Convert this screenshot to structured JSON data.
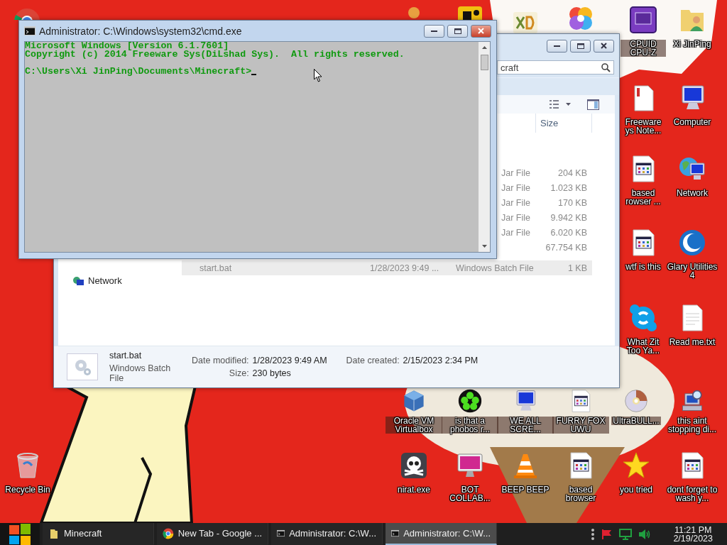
{
  "desktop": {
    "icons": [
      {
        "kind": "circle-logo"
      },
      {
        "kind": "person"
      },
      {
        "kind": "app"
      },
      {
        "kind": "app-light"
      },
      {
        "kind": "pinwheel"
      },
      {
        "kind": "chip",
        "label": "CPUID CPU-Z"
      },
      {
        "kind": "user-folder",
        "label": "Xi JinPing"
      },
      {
        "kind": "page",
        "label": "Freeware ys Note..."
      },
      {
        "kind": "computer",
        "label": "Computer"
      },
      {
        "kind": "batch",
        "label": "based rowser ..."
      },
      {
        "kind": "network",
        "label": "Network"
      },
      {
        "kind": "batch",
        "label": "wtf is this"
      },
      {
        "kind": "crescent",
        "label": "Glary Utilities 4"
      },
      {
        "kind": "chat",
        "label": "What Zit Too Ya..."
      },
      {
        "kind": "text-file",
        "label": "Read me.txt"
      },
      {
        "kind": "cube",
        "label": "Oracle VM Virtualbox"
      },
      {
        "kind": "flower",
        "label": "is that a phobos r..."
      },
      {
        "kind": "computer",
        "label": "WE ALL SCRE..."
      },
      {
        "kind": "batch",
        "label": "FURRY FOX UWU"
      },
      {
        "kind": "disc",
        "label": "UltraBULL..."
      },
      {
        "kind": "search-pc",
        "label": "this aint stopping di..."
      },
      {
        "kind": "recycle",
        "label": "Recycle Bin"
      },
      {
        "kind": "skull",
        "label": "nirat.exe"
      },
      {
        "kind": "monitor",
        "label": "BOT COLLAB..."
      },
      {
        "kind": "cone",
        "label": "BEEP BEEP"
      },
      {
        "kind": "batch",
        "label": "based browser"
      },
      {
        "kind": "star",
        "label": "you tried"
      },
      {
        "kind": "batch",
        "label": "dont forget to wash y..."
      }
    ]
  },
  "explorer": {
    "search": {
      "value": "craft"
    },
    "size_column": "Size",
    "rows": [
      {
        "type": "Jar File",
        "size": "204 KB",
        "selected": false
      },
      {
        "type": "Jar File",
        "size": "1.023 KB",
        "selected": false
      },
      {
        "type": "Jar File",
        "size": "170 KB",
        "selected": false
      },
      {
        "type": "Jar File",
        "size": "9.942 KB",
        "selected": false
      },
      {
        "type": "Jar File",
        "size": "6.020 KB",
        "selected": false
      },
      {
        "size": "67.754 KB",
        "selected": false
      },
      {
        "name": "start.bat",
        "modified": "1/28/2023 9:49 ...",
        "type": "Windows Batch File",
        "size": "1 KB",
        "selected": true
      }
    ],
    "nav": [
      {
        "label": "Network"
      }
    ],
    "details": {
      "name": "start.bat",
      "type": "Windows Batch File",
      "fields": [
        {
          "label": "Date modified:",
          "value": "1/28/2023 9:49 AM"
        },
        {
          "label": "Date created:",
          "value": "2/15/2023 2:34 PM"
        },
        {
          "label": "Size:",
          "value": "230 bytes"
        }
      ]
    }
  },
  "console": {
    "title": "Administrator: C:\\Windows\\system32\\cmd.exe",
    "lines": [
      "Microsoft Windows [Version 6.1.7601]",
      "Copyright (c) 2014 Freeware Sys(DiLshad Sys).  All rights reserved."
    ],
    "prompt": "C:\\Users\\Xi JinPing\\Documents\\Minecraft>"
  },
  "taskbar": {
    "tasks": [
      {
        "kind": "folder",
        "label": "Minecraft",
        "selected": false
      },
      {
        "kind": "browser",
        "label": "New Tab - Google ...",
        "selected": false
      },
      {
        "kind": "console",
        "label": "Administrator: C:\\W...",
        "selected": false
      },
      {
        "kind": "console",
        "label": "Administrator: C:\\W...",
        "selected": true
      }
    ],
    "clock": {
      "time": "11:21 PM",
      "date": "2/19/2023"
    }
  }
}
